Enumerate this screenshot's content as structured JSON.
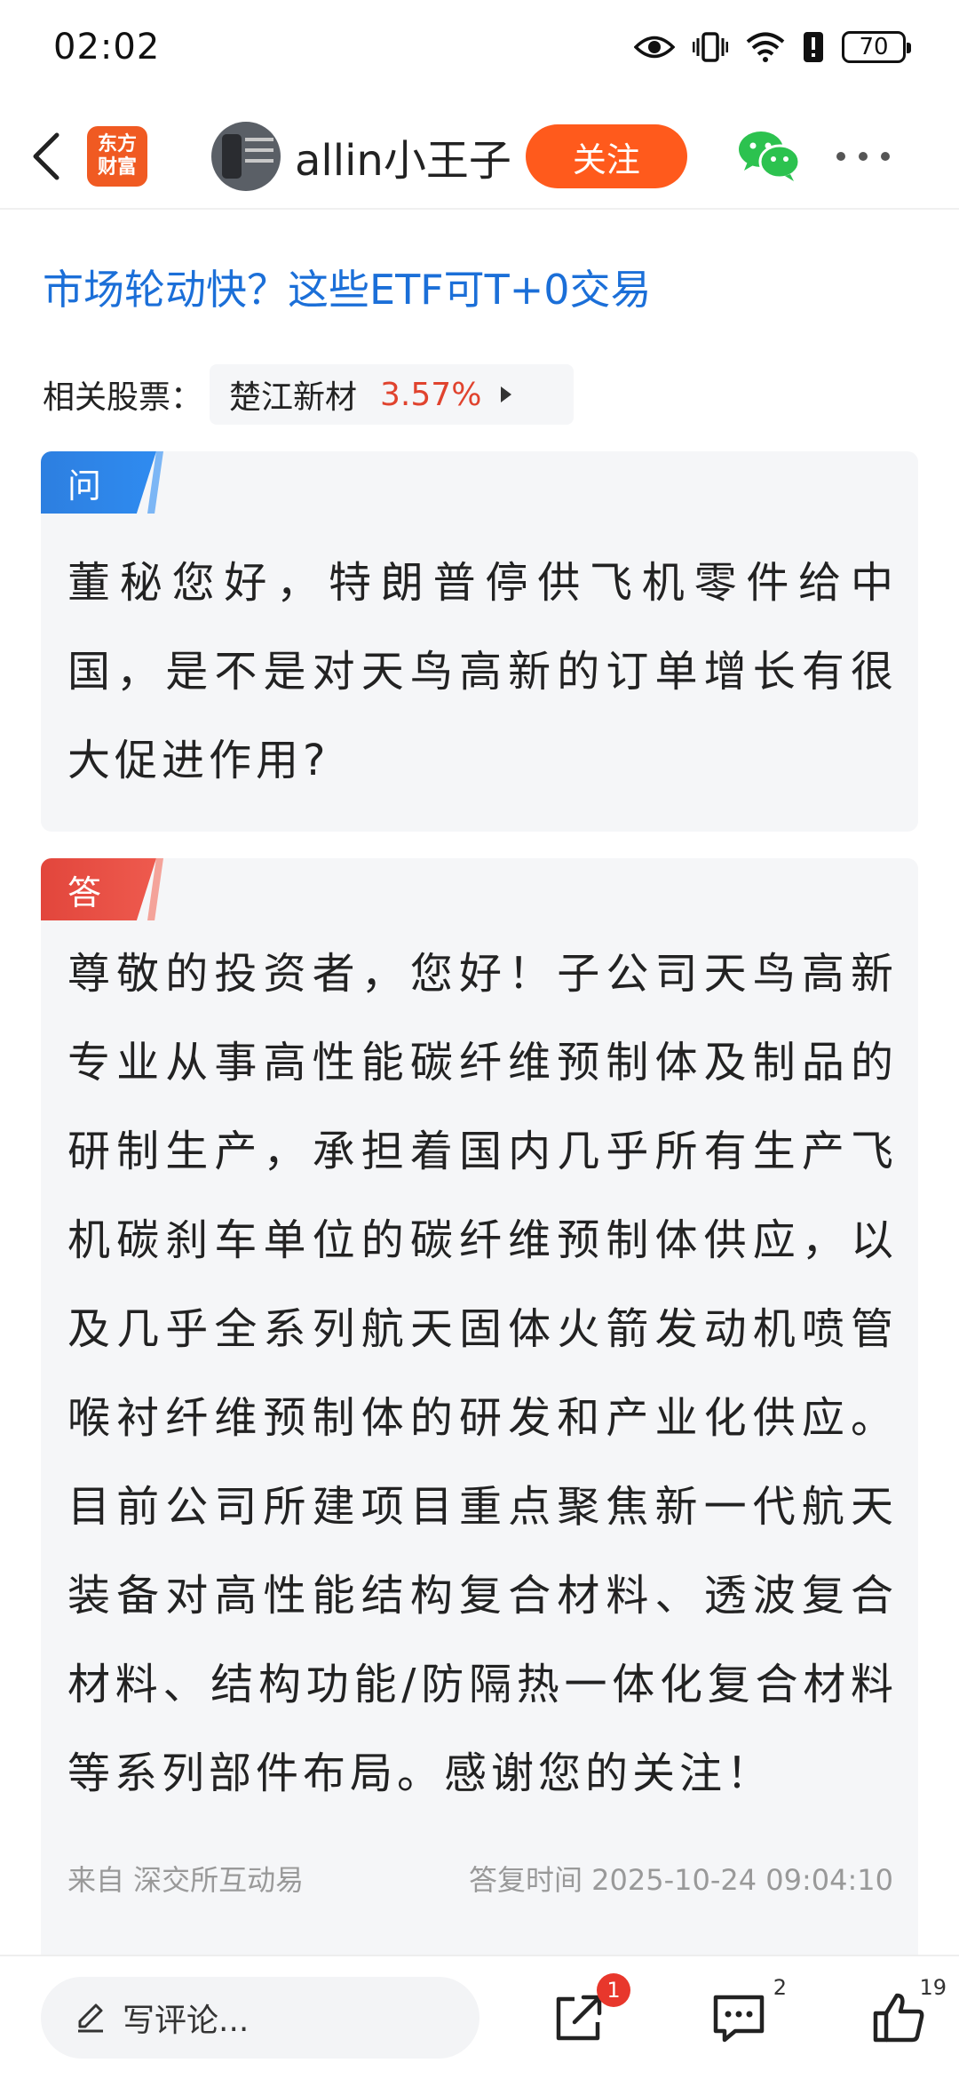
{
  "status_bar": {
    "time": "02:02",
    "icons": [
      "eye-icon",
      "vibrate-icon",
      "wifi-icon",
      "alert-icon"
    ],
    "battery": "70"
  },
  "header": {
    "back_icon": "back-arrow-icon",
    "brand_logo_line1": "东方",
    "brand_logo_line2": "财富",
    "username": "allin小王子",
    "follow_label": "关注",
    "wechat_icon": "wechat-icon",
    "more_icon": "more-dots-icon"
  },
  "article": {
    "title": "市场轮动快？这些ETF可T+0交易",
    "related_label": "相关股票：",
    "related_stock": {
      "name": "楚江新材",
      "change": "3.57%",
      "change_color": "#e0432e"
    }
  },
  "question": {
    "tag": "问",
    "text": "董秘您好，特朗普停供飞机零件给中国，是不是对天鸟高新的订单增长有很大促进作用?"
  },
  "answer": {
    "tag": "答",
    "text": "尊敬的投资者，您好！子公司天鸟高新专业从事高性能碳纤维预制体及制品的研制生产，承担着国内几乎所有生产飞机碳刹车单位的碳纤维预制体供应，以及几乎全系列航天固体火箭发动机喷管喉衬纤维预制体的研发和产业化供应。目前公司所建项目重点聚焦新一代航天装备对高性能结构复合材料、透波复合材料、结构功能/防隔热一体化复合材料等系列部件布局。感谢您的关注！",
    "source": "来自 深交所互动易",
    "reply_time": "答复时间 2025-10-24 09:04:10"
  },
  "bottom_bar": {
    "comment_placeholder": "写评论...",
    "share_badge": "1",
    "comment_count": "2",
    "like_count": "19"
  },
  "colors": {
    "accent_orange": "#ff5a1c",
    "title_blue": "#1b6fd8",
    "question_blue": "#2d7fe0",
    "answer_red": "#e2463c"
  }
}
